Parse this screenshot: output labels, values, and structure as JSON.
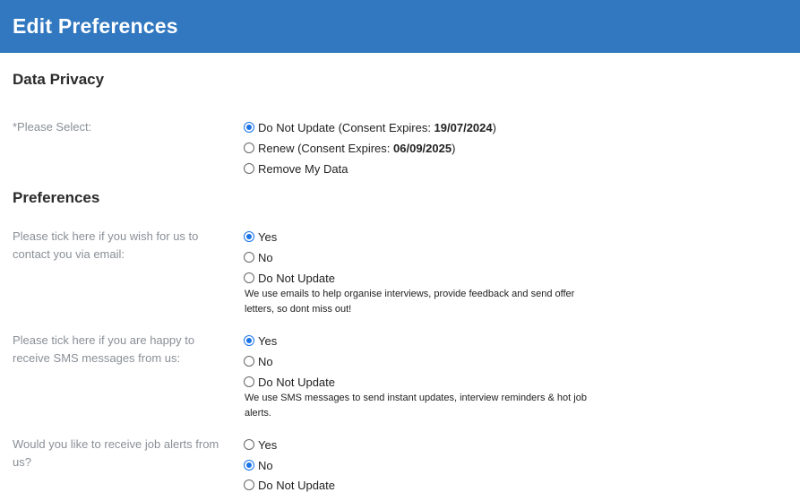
{
  "header": {
    "title": "Edit Preferences"
  },
  "data_privacy": {
    "title": "Data Privacy",
    "label": "*Please Select:",
    "options": [
      {
        "text": "Do Not Update (Consent Expires: ",
        "date": "19/07/2024",
        "suffix": ")",
        "checked": true
      },
      {
        "text": "Renew (Consent Expires: ",
        "date": "06/09/2025",
        "suffix": ")",
        "checked": false
      },
      {
        "text": "Remove My Data",
        "checked": false
      }
    ]
  },
  "preferences": {
    "title": "Preferences",
    "email": {
      "label": "Please tick here if you wish for us to contact you via email:",
      "options": [
        {
          "text": "Yes",
          "checked": true
        },
        {
          "text": "No",
          "checked": false
        },
        {
          "text": "Do Not Update",
          "checked": false
        }
      ],
      "note": "We use emails to help organise interviews, provide feedback and send offer letters, so dont miss out!"
    },
    "sms": {
      "label": "Please tick here if you are happy to receive SMS messages from us:",
      "options": [
        {
          "text": "Yes",
          "checked": true
        },
        {
          "text": "No",
          "checked": false
        },
        {
          "text": "Do Not Update",
          "checked": false
        }
      ],
      "note": "We use SMS messages to send instant updates, interview reminders & hot job alerts."
    },
    "job_alerts": {
      "label": "Would you like to receive job alerts from us?",
      "options": [
        {
          "text": "Yes",
          "checked": false
        },
        {
          "text": "No",
          "checked": true
        },
        {
          "text": "Do Not Update",
          "checked": false
        }
      ]
    }
  }
}
